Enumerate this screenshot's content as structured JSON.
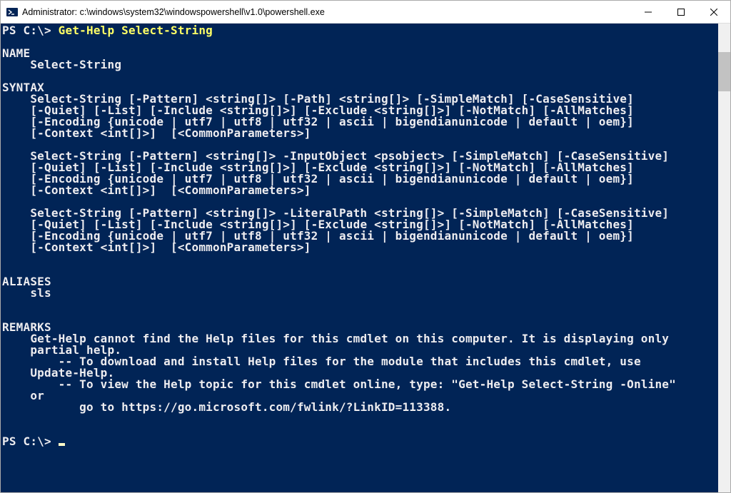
{
  "titlebar": {
    "text": "Administrator: c:\\windows\\system32\\windowspowershell\\v1.0\\powershell.exe"
  },
  "prompt1": {
    "prefix": "PS C:\\> ",
    "cmd": "Get-Help Select-String"
  },
  "help": {
    "name_header": "NAME",
    "name_body": "    Select-String",
    "syntax_header": "SYNTAX",
    "syntax1_l1": "    Select-String [-Pattern] <string[]> [-Path] <string[]> [-SimpleMatch] [-CaseSensitive]",
    "syntax1_l2": "    [-Quiet] [-List] [-Include <string[]>] [-Exclude <string[]>] [-NotMatch] [-AllMatches]",
    "syntax1_l3": "    [-Encoding {unicode | utf7 | utf8 | utf32 | ascii | bigendianunicode | default | oem}]",
    "syntax1_l4": "    [-Context <int[]>]  [<CommonParameters>]",
    "syntax2_l1": "    Select-String [-Pattern] <string[]> -InputObject <psobject> [-SimpleMatch] [-CaseSensitive]",
    "syntax2_l2": "    [-Quiet] [-List] [-Include <string[]>] [-Exclude <string[]>] [-NotMatch] [-AllMatches]",
    "syntax2_l3": "    [-Encoding {unicode | utf7 | utf8 | utf32 | ascii | bigendianunicode | default | oem}]",
    "syntax2_l4": "    [-Context <int[]>]  [<CommonParameters>]",
    "syntax3_l1": "    Select-String [-Pattern] <string[]> -LiteralPath <string[]> [-SimpleMatch] [-CaseSensitive]",
    "syntax3_l2": "    [-Quiet] [-List] [-Include <string[]>] [-Exclude <string[]>] [-NotMatch] [-AllMatches]",
    "syntax3_l3": "    [-Encoding {unicode | utf7 | utf8 | utf32 | ascii | bigendianunicode | default | oem}]",
    "syntax3_l4": "    [-Context <int[]>]  [<CommonParameters>]",
    "aliases_header": "ALIASES",
    "aliases_body": "    sls",
    "remarks_header": "REMARKS",
    "remarks_l1": "    Get-Help cannot find the Help files for this cmdlet on this computer. It is displaying only",
    "remarks_l2": "    partial help.",
    "remarks_l3": "        -- To download and install Help files for the module that includes this cmdlet, use",
    "remarks_l4": "    Update-Help.",
    "remarks_l5": "        -- To view the Help topic for this cmdlet online, type: \"Get-Help Select-String -Online\"",
    "remarks_l6": "    or",
    "remarks_l7": "           go to https://go.microsoft.com/fwlink/?LinkID=113388."
  },
  "prompt2": {
    "prefix": "PS C:\\> "
  }
}
